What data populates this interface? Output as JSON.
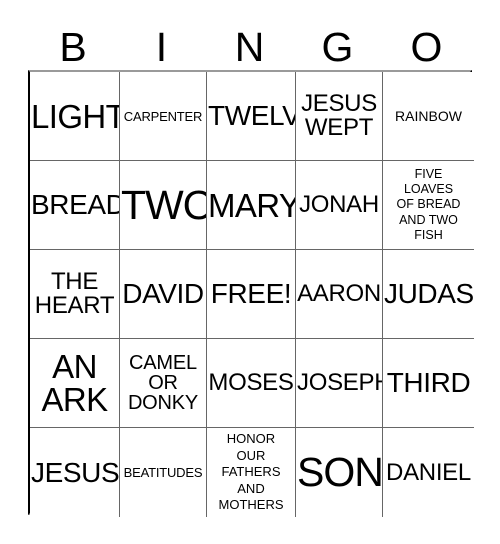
{
  "card": {
    "type": "bingo-card",
    "columns": 5,
    "rows": 5,
    "header": {
      "letters": [
        "B",
        "I",
        "N",
        "G",
        "O"
      ]
    },
    "free_space": {
      "row": 3,
      "column": 3,
      "label": "FREE!"
    },
    "cells": [
      [
        {
          "text": "LIGHT",
          "size": "sz-xl"
        },
        {
          "text": "CARPENTER",
          "size": "sz-xxs"
        },
        {
          "text": "TWELVE",
          "size": "sz-l"
        },
        {
          "text": "JESUS\nWEPT",
          "size": "sz-m"
        },
        {
          "text": "RAINBOW",
          "size": "sz-xs"
        }
      ],
      [
        {
          "text": "BREAD",
          "size": "sz-l"
        },
        {
          "text": "TWO",
          "size": "sz-xxl"
        },
        {
          "text": "MARY",
          "size": "sz-xl"
        },
        {
          "text": "JONAH",
          "size": "sz-m"
        },
        {
          "text": "FIVE\nLOAVES\nOF BREAD\nAND TWO\nFISH",
          "size": "sz-tiny"
        }
      ],
      [
        {
          "text": "THE\nHEART",
          "size": "sz-m"
        },
        {
          "text": "DAVID",
          "size": "sz-l"
        },
        {
          "text": "FREE!",
          "size": "sz-l"
        },
        {
          "text": "AARON",
          "size": "sz-m"
        },
        {
          "text": "JUDAS",
          "size": "sz-l"
        }
      ],
      [
        {
          "text": "AN\nARK",
          "size": "sz-xl"
        },
        {
          "text": "CAMEL\nOR\nDONKY",
          "size": "sz-s"
        },
        {
          "text": "MOSES",
          "size": "sz-m"
        },
        {
          "text": "JOSEPH",
          "size": "sz-m"
        },
        {
          "text": "THIRD",
          "size": "sz-l"
        }
      ],
      [
        {
          "text": "JESUS",
          "size": "sz-l"
        },
        {
          "text": "BEATITUDES",
          "size": "sz-xxs"
        },
        {
          "text": "HONOR\nOUR\nFATHERS\nAND\nMOTHERS",
          "size": "sz-tiny2"
        },
        {
          "text": "SON",
          "size": "sz-xxl"
        },
        {
          "text": "DANIEL",
          "size": "sz-m"
        }
      ]
    ]
  },
  "colors": {
    "background": "#ffffff",
    "text": "#000000",
    "grid_line": "#666666",
    "card_border": "#000000"
  }
}
